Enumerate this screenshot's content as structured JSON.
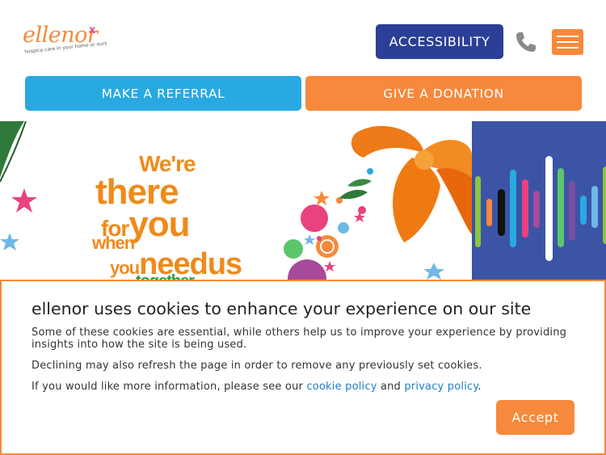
{
  "header": {
    "logo_word": "ellenor",
    "logo_mark": "x",
    "logo_tagline": "hospice care in your home or ours",
    "accessibility_label": "ACCESSIBILITY",
    "phone_icon": "phone-icon",
    "menu_icon": "hamburger-menu-icon",
    "referral_label": "MAKE A REFERRAL",
    "donation_label": "GIVE A DONATION"
  },
  "hero": {
    "line1": "We're",
    "line2": "there",
    "line3a": "for",
    "line3b": "you",
    "line4": "when",
    "line5a": "you",
    "line5b": "need",
    "line5c": "us",
    "line6": "together"
  },
  "cookie_banner": {
    "title": "ellenor uses cookies to enhance your experience on our site",
    "paragraph1": "Some of these cookies are essential, while others help us to improve your experience by providing insights into how the site is being used.",
    "paragraph2": "Declining may also refresh the page in order to remove any previously set cookies.",
    "paragraph3_prefix": "If you would like more information, please see our ",
    "cookie_policy_link": "cookie policy",
    "paragraph3_middle": " and ",
    "privacy_policy_link": "privacy policy",
    "paragraph3_suffix": ".",
    "accept_label": "Accept"
  },
  "colors": {
    "brand_orange": "#f6893b",
    "brand_navy": "#2b3f97",
    "brand_blue": "#29a9e1",
    "link_blue": "#1d7fc6",
    "hero_text_orange": "#f08a1b",
    "audio_panel_bg": "#3b54a6"
  }
}
